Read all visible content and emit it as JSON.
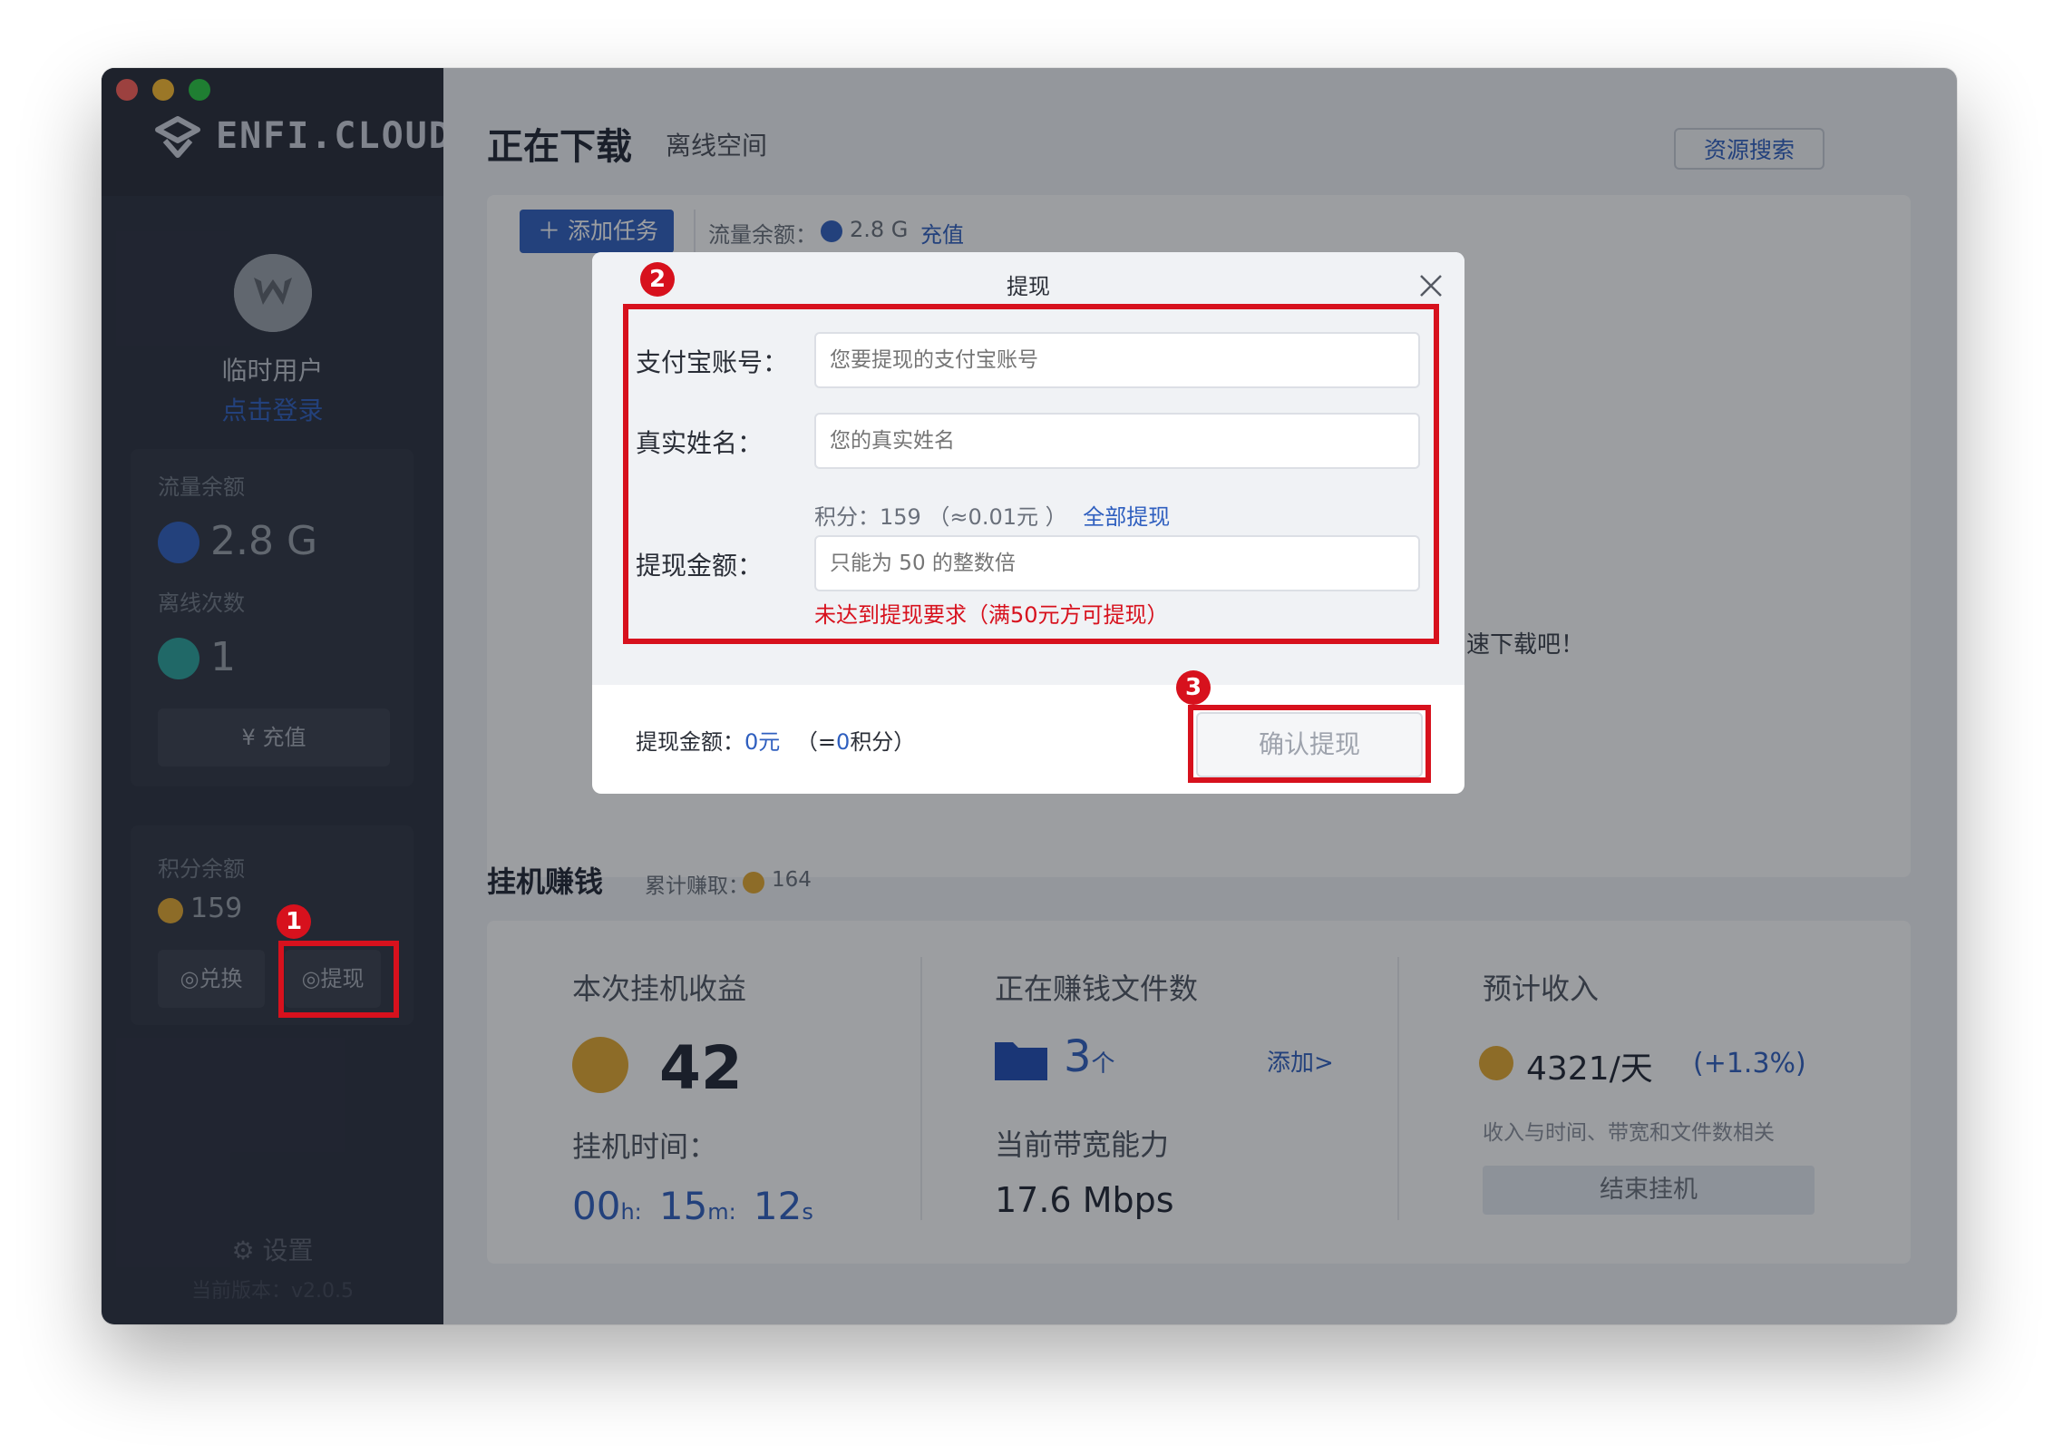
{
  "app": {
    "logo_text": "ENFI.CLOUD",
    "traffic_lights": [
      "#ff5f57",
      "#febc2e",
      "#28c840"
    ]
  },
  "sidebar": {
    "user_name": "临时用户",
    "login_link": "点击登录",
    "traffic_card": {
      "traffic_label": "流量余额",
      "traffic_value": "2.8 G",
      "offline_label": "离线次数",
      "offline_value": "1",
      "recharge_button": "充值"
    },
    "points_card": {
      "label": "积分余额",
      "value": "159",
      "exchange_button": "兑换",
      "withdraw_button": "提现"
    },
    "settings_label": "设置",
    "version": "当前版本：v2.0.5"
  },
  "header": {
    "title": "正在下载",
    "tab_offline": "离线空间",
    "resource_search": "资源搜索"
  },
  "download_panel": {
    "add_task": "添加任务",
    "traffic_label": "流量余额：",
    "traffic_value": "2.8 G",
    "recharge_link": "充值",
    "empty_text": "速下载吧！"
  },
  "earn": {
    "title": "挂机赚钱",
    "cumulative_label": "累计赚取：",
    "cumulative_value": "164",
    "session_income_label": "本次挂机收益",
    "session_income_value": "42",
    "time_label": "挂机时间：",
    "time_h": "00",
    "time_h_unit": "h:",
    "time_m": "15",
    "time_m_unit": "m:",
    "time_s": "12",
    "time_s_unit": "s",
    "files_label": "正在赚钱文件数",
    "files_value": "3",
    "files_unit": "个",
    "add_link": "添加>",
    "bandwidth_label": "当前带宽能力",
    "bandwidth_value": "17.6 Mbps",
    "expected_label": "预计收入",
    "expected_value": "4321/天",
    "expected_change": "(+1.3%)",
    "expected_note": "收入与时间、带宽和文件数相关",
    "stop_button": "结束挂机"
  },
  "dialog": {
    "title": "提现",
    "alipay_label": "支付宝账号：",
    "alipay_placeholder": "您要提现的支付宝账号",
    "name_label": "真实姓名：",
    "name_placeholder": "您的真实姓名",
    "points_info": "积分：159 （≈0.01元 ）",
    "withdraw_all": "全部提现",
    "amount_label": "提现金额：",
    "amount_placeholder": "只能为 50 的整数倍",
    "error_text": "未达到提现要求（满50元方可提现）",
    "summary_label": "提现金额：",
    "summary_value": "0元",
    "summary_points_open": "（=",
    "summary_points_value": "0",
    "summary_points_close": "积分）",
    "confirm_button": "确认提现"
  },
  "annotations": {
    "badge_1": "1",
    "badge_2": "2",
    "badge_3": "3",
    "highlight_color": "#d7111d"
  }
}
